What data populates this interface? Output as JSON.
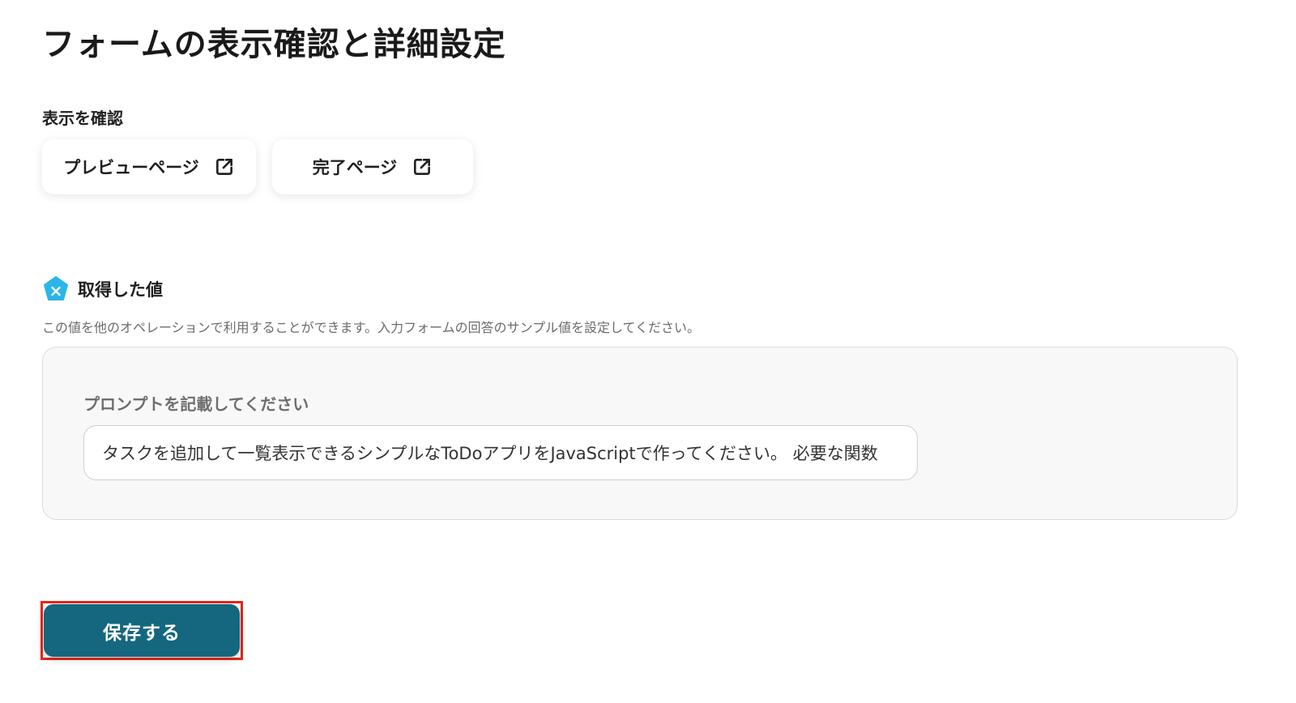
{
  "page": {
    "title": "フォームの表示確認と詳細設定"
  },
  "display_check": {
    "label": "表示を確認",
    "preview_label": "プレビューページ",
    "complete_label": "完了ページ",
    "icon": "external-link-icon"
  },
  "acquired": {
    "icon": "x-pentagon-icon",
    "icon_color": "#2bb5e8",
    "title": "取得した値",
    "description": "この値を他のオペレーションで利用することができます。入力フォームの回答のサンプル値を設定してください。",
    "field_label": "プロンプトを記載してください",
    "field_value": "タスクを追加して一覧表示できるシンプルなToDoアプリをJavaScriptで作ってください。 必要な関数"
  },
  "actions": {
    "save_label": "保存する",
    "save_color": "#14677f",
    "highlight_color": "#e8261b"
  }
}
